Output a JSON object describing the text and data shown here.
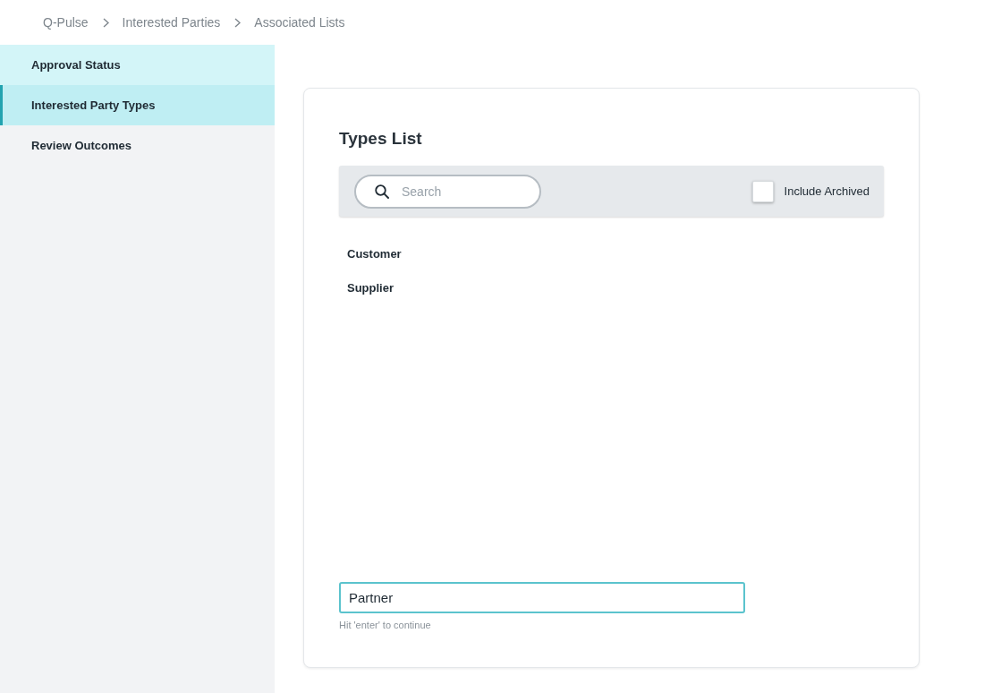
{
  "breadcrumb": [
    {
      "label": "Q-Pulse"
    },
    {
      "label": "Interested Parties"
    },
    {
      "label": "Associated Lists"
    }
  ],
  "sidebar": {
    "items": [
      {
        "label": "Approval Status",
        "selected": false,
        "hovered": true
      },
      {
        "label": "Interested Party Types",
        "selected": true,
        "hovered": false
      },
      {
        "label": "Review Outcomes",
        "selected": false,
        "hovered": false
      }
    ]
  },
  "types_list": {
    "title": "Types List",
    "search": {
      "placeholder": "Search"
    },
    "include_archived": {
      "label": "Include Archived",
      "checked": false
    },
    "items": [
      "Customer",
      "Supplier"
    ],
    "new_item": {
      "value": "Partner",
      "focused": true,
      "hint": "Hit 'enter' to continue"
    }
  }
}
